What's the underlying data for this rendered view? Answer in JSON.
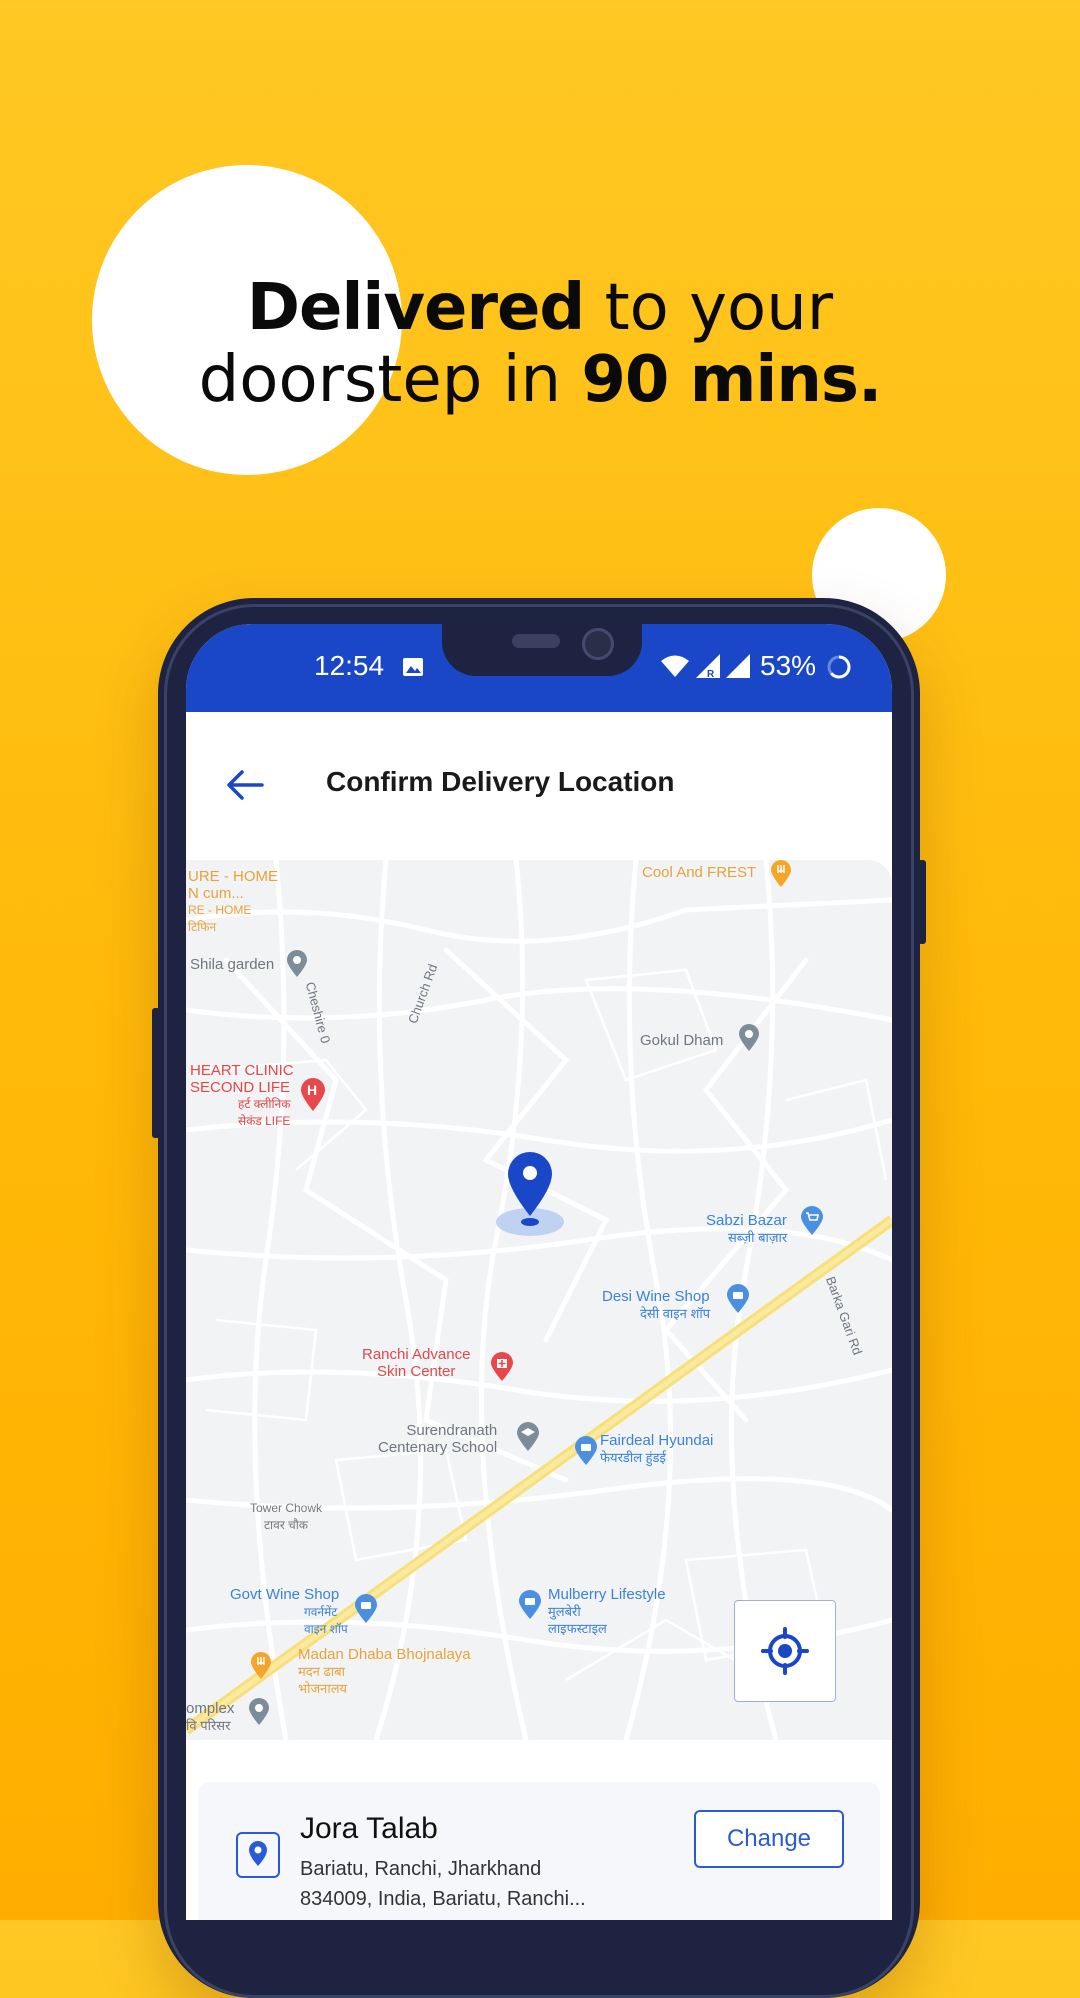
{
  "headline": {
    "bold_1": "Delivered",
    "rest_1": " to your",
    "rest_2": "doorstep in ",
    "bold_2": "90 mins."
  },
  "statusbar": {
    "time": "12:54",
    "battery": "53%"
  },
  "header": {
    "title": "Confirm Delivery Location"
  },
  "map": {
    "pois": [
      {
        "name": "URE - HOME",
        "name2": "N cum...",
        "name3": "RE - HOME",
        "name4": "टिफिन"
      },
      {
        "name": "Cool And FREST"
      },
      {
        "name": "Shila garden"
      },
      {
        "name": "Cheshire 0"
      },
      {
        "name": "Church Rd"
      },
      {
        "name": "Gokul Dham"
      },
      {
        "name": "HEART CLINIC",
        "name2": "SECOND LIFE",
        "name3": "हर्ट क्लीनिक",
        "name4": "सेकंड LIFE"
      },
      {
        "name": "Sabzi Bazar",
        "name2": "सब्ज़ी बाज़ार"
      },
      {
        "name": "Desi Wine Shop",
        "name2": "देसी वाइन शॉप"
      },
      {
        "name": "Barka Gari Rd"
      },
      {
        "name": "Ranchi Advance",
        "name2": "Skin Center"
      },
      {
        "name": "Surendranath",
        "name2": "Centenary School"
      },
      {
        "name": "Fairdeal Hyundai",
        "name2": "फेयरडील हुंडई"
      },
      {
        "name": "Tower Chowk",
        "name2": "टावर चौक"
      },
      {
        "name": "Govt Wine Shop",
        "name2": "गवर्नमेंट",
        "name3": "वाइन शॉप"
      },
      {
        "name": "Mulberry Lifestyle",
        "name2": "मुलबेरी",
        "name3": "लाइफस्टाइल"
      },
      {
        "name": "Madan Dhaba Bhojnalaya",
        "name2": "मदन ढाबा",
        "name3": "भोजनालय"
      },
      {
        "name": "omplex",
        "name2": "वि परिसर"
      }
    ]
  },
  "address": {
    "title": "Jora Talab",
    "line1": "Bariatu, Ranchi, Jharkhand",
    "line2": "834009, India, Bariatu, Ranchi...",
    "change_label": "Change"
  },
  "colors": {
    "background": "#FFBE10",
    "statusbar": "#1A47C8",
    "accent": "#2A5BD7",
    "pin": "#1A47C8"
  }
}
